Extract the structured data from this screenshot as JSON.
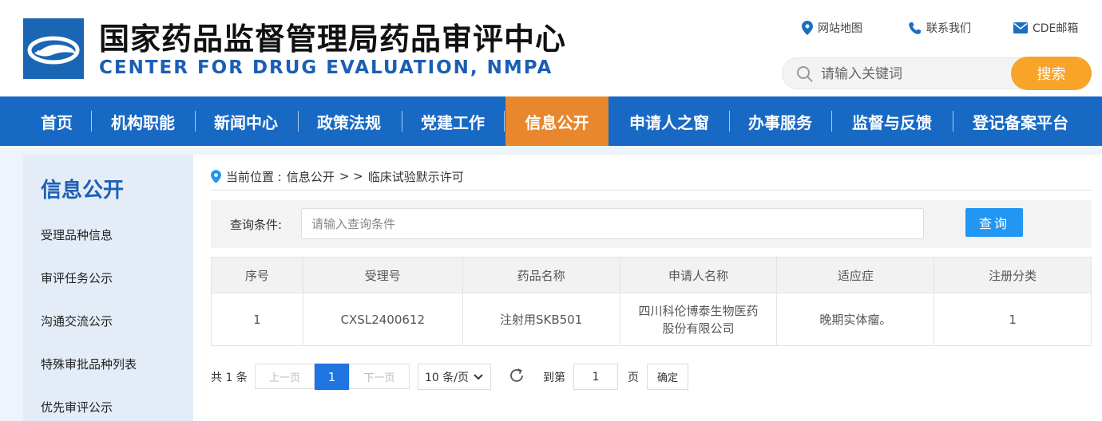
{
  "header": {
    "title_cn": "国家药品监督管理局药品审评中心",
    "title_en": "CENTER FOR DRUG EVALUATION, NMPA",
    "links": [
      {
        "label": "网站地图",
        "icon": "location-pin-icon"
      },
      {
        "label": "联系我们",
        "icon": "phone-icon"
      },
      {
        "label": "CDE邮箱",
        "icon": "mail-icon"
      }
    ],
    "search": {
      "placeholder": "请输入关键词",
      "button": "搜索"
    }
  },
  "nav": {
    "items": [
      "首页",
      "机构职能",
      "新闻中心",
      "政策法规",
      "党建工作",
      "信息公开",
      "申请人之窗",
      "办事服务",
      "监督与反馈",
      "登记备案平台"
    ],
    "active": "信息公开"
  },
  "sidebar": {
    "title": "信息公开",
    "items": [
      "受理品种信息",
      "审评任务公示",
      "沟通交流公示",
      "特殊审批品种列表",
      "优先审评公示"
    ]
  },
  "breadcrumb": {
    "prefix": "当前位置 :",
    "level1": "信息公开",
    "separator": "> >",
    "current": "临床试验默示许可"
  },
  "query": {
    "label": "查询条件:",
    "placeholder": "请输入查询条件",
    "button": "查询"
  },
  "table": {
    "headers": [
      "序号",
      "受理号",
      "药品名称",
      "申请人名称",
      "适应症",
      "注册分类"
    ],
    "rows": [
      [
        "1",
        "CXSL2400612",
        "注射用SKB501",
        "四川科伦博泰生物医药股份有限公司",
        "晚期实体瘤。",
        "1"
      ]
    ]
  },
  "pagination": {
    "total_text": "共 1 条",
    "prev": "上一页",
    "current_page": "1",
    "next": "下一页",
    "page_size": "10 条/页",
    "goto_prefix": "到第",
    "goto_value": "1",
    "goto_suffix": "页",
    "confirm": "确定"
  },
  "colors": {
    "nav_bg": "#1769c4",
    "nav_active": "#e8872d",
    "search_button": "#f7a428",
    "brand_blue": "#1b5eb4",
    "query_button": "#2196f3"
  }
}
